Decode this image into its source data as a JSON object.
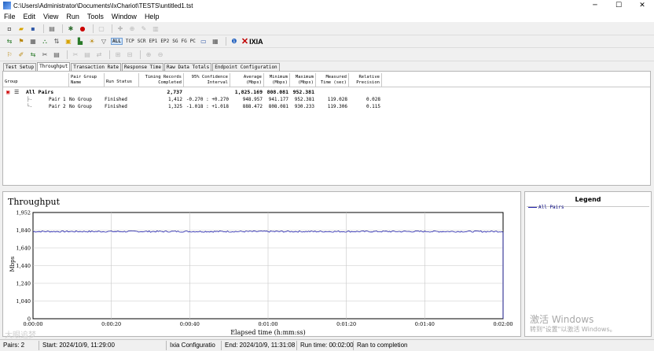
{
  "window": {
    "title": "C:\\Users\\Administrator\\Documents\\IxChariot\\TESTS\\untitled1.tst",
    "minimize": "─",
    "maximize": "☐",
    "close": "✕"
  },
  "menu": [
    "File",
    "Edit",
    "View",
    "Run",
    "Tools",
    "Window",
    "Help"
  ],
  "toolbar2": {
    "protocols": [
      "ALL",
      "TCP",
      "SCR",
      "EP1",
      "EP2",
      "SG",
      "FG",
      "PC"
    ],
    "logo": "IXIA"
  },
  "tabs": [
    "Test Setup",
    "Throughput",
    "Transaction Rate",
    "Response Time",
    "Raw Data Totals",
    "Endpoint Configuration"
  ],
  "grid": {
    "headers": {
      "group": "Group",
      "pair_group_name": "Pair Group\nName",
      "run_status": "Run Status",
      "timing_records": "Timing Records\nCompleted",
      "confidence": "95% Confidence\nInterval",
      "average": "Average\n(Mbps)",
      "minimum": "Minimum\n(Mbps)",
      "maximum": "Maximum\n(Mbps)",
      "measured_time": "Measured\nTime (sec)",
      "relative_precision": "Relative\nPrecision"
    },
    "summary": {
      "label": "All Pairs",
      "timing_records": "2,737",
      "average": "1,825.169",
      "minimum": "808.081",
      "maximum": "952.381"
    },
    "rows": [
      {
        "pair": "Pair 1",
        "group": "No Group",
        "status": "Finished",
        "timing": "1,412",
        "ci": "-0.270 : +0.270",
        "avg": "948.957",
        "min": "941.177",
        "max": "952.381",
        "time": "119.028",
        "rp": "0.028"
      },
      {
        "pair": "Pair 2",
        "group": "No Group",
        "status": "Finished",
        "timing": "1,325",
        "ci": "-1.018 : +1.018",
        "avg": "888.472",
        "min": "808.081",
        "max": "930.233",
        "time": "119.306",
        "rp": "0.115"
      }
    ]
  },
  "chart_data": {
    "type": "line",
    "title": "Throughput",
    "xlabel": "Elapsed time (h:mm:ss)",
    "ylabel": "Mbps",
    "x_ticks": [
      "0:00:00",
      "0:00:20",
      "0:00:40",
      "0:01:00",
      "0:01:20",
      "0:01:40",
      "0:02:00"
    ],
    "y_ticks": [
      "1,952",
      "1,840",
      "1,640",
      "1,440",
      "1,240",
      "1,040",
      "0"
    ],
    "xlim": [
      0,
      120
    ],
    "ylim": [
      0,
      1952
    ],
    "series": [
      {
        "name": "All Pairs",
        "color": "#1a1aa6",
        "mean": 1825,
        "noise": 8,
        "end_drop_to": 0
      }
    ]
  },
  "legend": {
    "title": "Legend",
    "items": [
      "All Pairs"
    ]
  },
  "status": {
    "pairs": "Pairs: 2",
    "start": "Start: 2024/10/9, 11:29:00",
    "config": "Ixia Configuratio",
    "end": "End: 2024/10/9, 11:31:08",
    "run_time": "Run time: 00:02:00",
    "completion": "Ran to completion"
  },
  "watermark": {
    "activate": "激活 Windows",
    "goto": "转到\"设置\"以激活 Windows。",
    "brand": "大眼追梦"
  }
}
